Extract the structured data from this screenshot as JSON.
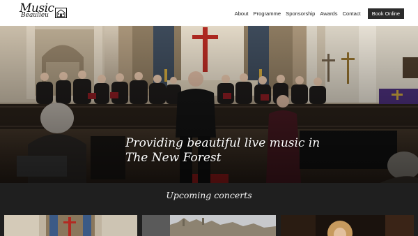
{
  "header": {
    "logo": {
      "line1": "Music",
      "line2": "Beaulieu",
      "icon": "church-icon"
    },
    "nav": [
      {
        "label": "About"
      },
      {
        "label": "Programme"
      },
      {
        "label": "Sponsorship"
      },
      {
        "label": "Awards"
      },
      {
        "label": "Contact"
      }
    ],
    "book_button": "Book Online"
  },
  "hero": {
    "title_line1": "Providing beautiful live music in",
    "title_line2": "The New Forest"
  },
  "upcoming": {
    "title": "Upcoming concerts"
  },
  "colors": {
    "header_bg": "#ffffff",
    "button_bg": "#2b2b2b",
    "section_bg": "#1f1f1f",
    "text_light": "#ffffff"
  }
}
